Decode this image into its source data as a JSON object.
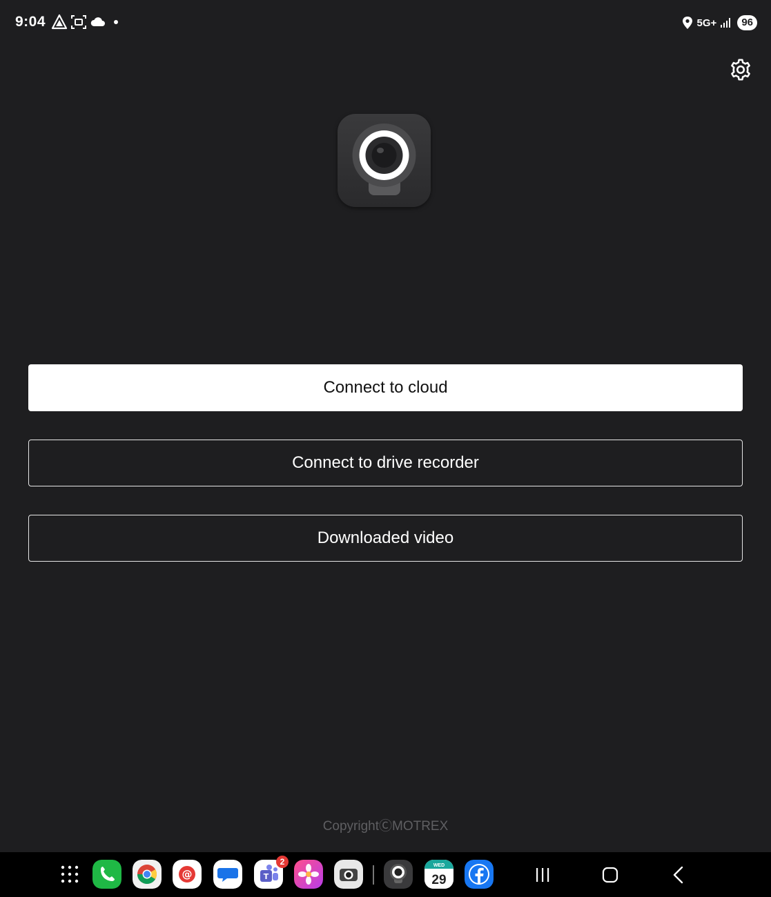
{
  "status_bar": {
    "time": "9:04",
    "network": "5G+",
    "battery": "96",
    "left_icons": [
      "drive-icon",
      "screenshot-icon",
      "cloud-icon",
      "dot-icon"
    ],
    "right_icons": [
      "location-icon",
      "signal-icon"
    ]
  },
  "header": {
    "settings_icon": "gear-icon"
  },
  "app": {
    "logo_icon": "dashcam-logo-icon"
  },
  "buttons": {
    "connect_cloud": "Connect to cloud",
    "connect_drive_recorder": "Connect to drive recorder",
    "downloaded_video": "Downloaded video"
  },
  "footer": {
    "copyright": "CopyrightⒸMOTREX"
  },
  "taskbar": {
    "apps": [
      {
        "name": "app-drawer-icon"
      },
      {
        "name": "phone-icon",
        "color": "#1fb845"
      },
      {
        "name": "chrome-icon"
      },
      {
        "name": "email-icon",
        "color": "#ffffff"
      },
      {
        "name": "messages-icon",
        "color": "#ffffff"
      },
      {
        "name": "teams-icon",
        "color": "#ffffff",
        "badge": "2"
      },
      {
        "name": "gallery-icon"
      },
      {
        "name": "camera-icon",
        "color": "#ffffff"
      },
      {
        "name": "dashcam-app-icon"
      },
      {
        "name": "calendar-icon",
        "day_label": "WED",
        "day_number": "29"
      },
      {
        "name": "facebook-icon",
        "color": "#1877f2"
      }
    ],
    "nav": [
      "recents-icon",
      "home-icon",
      "back-icon"
    ]
  }
}
